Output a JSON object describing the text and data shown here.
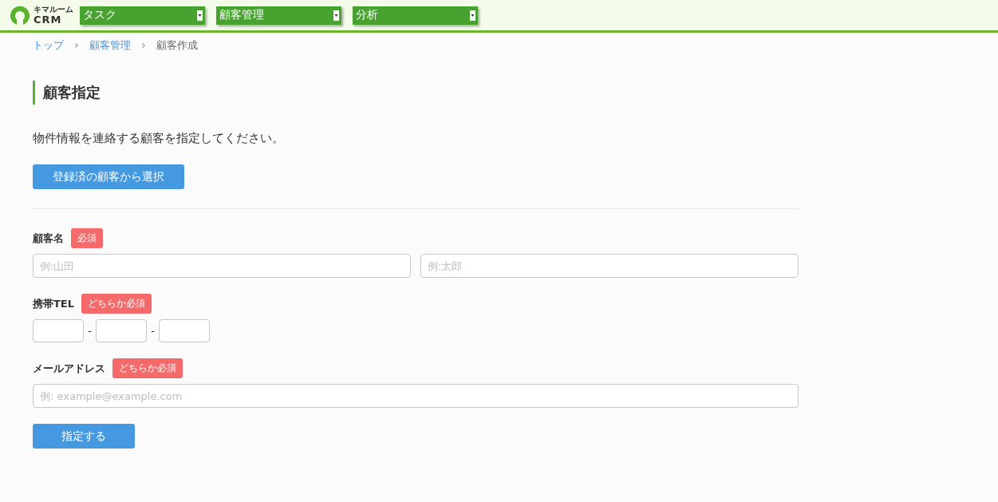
{
  "header": {
    "logo": {
      "kana": "キマルーム",
      "text": "CRM"
    },
    "menus": [
      {
        "label": "タスク"
      },
      {
        "label": "顧客管理"
      },
      {
        "label": "分析"
      }
    ]
  },
  "breadcrumb": [
    {
      "label": "トップ",
      "kind": "link"
    },
    {
      "label": "顧客管理",
      "kind": "link"
    },
    {
      "label": "顧客作成",
      "kind": "current"
    }
  ],
  "section": {
    "title": "顧客指定",
    "description": "物件情報を連絡する顧客を指定してください。",
    "select_button": "登録済の顧客から選択"
  },
  "form": {
    "fields": [
      {
        "kind": "name",
        "label": "顧客名",
        "badge": "必須",
        "inputs": [
          {
            "placeholder": "例:山田"
          },
          {
            "placeholder": "例:太郎"
          }
        ]
      },
      {
        "kind": "tel",
        "label": "携帯TEL",
        "badge": "どちらか必須",
        "separators": [
          "-",
          "-"
        ]
      },
      {
        "kind": "email",
        "label": "メールアドレス",
        "badge": "どちらか必須",
        "inputs": [
          {
            "placeholder": "例: example@example.com"
          }
        ]
      }
    ],
    "submit": "指定する"
  }
}
